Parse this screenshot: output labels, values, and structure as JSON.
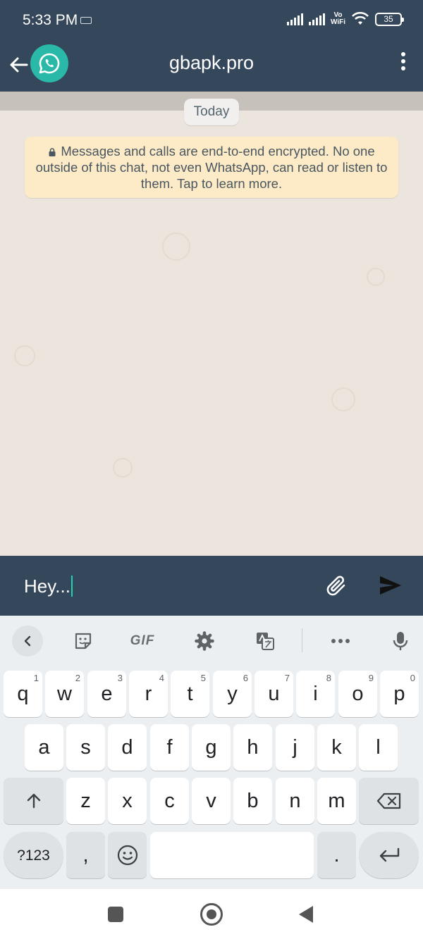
{
  "status_bar": {
    "time": "5:33 PM",
    "vowifi_top": "Vo",
    "vowifi_bottom": "WiFi",
    "battery": "35"
  },
  "header": {
    "title": "gbapk.pro",
    "back_icon": "arrow-left-icon",
    "avatar_icon": "whatsapp-logo-icon",
    "menu_icon": "more-vertical-icon"
  },
  "chat": {
    "date_label": "Today",
    "encryption_notice": "Messages and calls are end-to-end encrypted. No one outside of this chat, not even WhatsApp, can read or listen to them. Tap to learn more."
  },
  "compose": {
    "input_value": "Hey...",
    "attach_icon": "paperclip-icon",
    "send_icon": "send-icon"
  },
  "keyboard": {
    "toolbar": {
      "gif_label": "GIF"
    },
    "row1": [
      {
        "label": "q",
        "hint": "1"
      },
      {
        "label": "w",
        "hint": "2"
      },
      {
        "label": "e",
        "hint": "3"
      },
      {
        "label": "r",
        "hint": "4"
      },
      {
        "label": "t",
        "hint": "5"
      },
      {
        "label": "y",
        "hint": "6"
      },
      {
        "label": "u",
        "hint": "7"
      },
      {
        "label": "i",
        "hint": "8"
      },
      {
        "label": "o",
        "hint": "9"
      },
      {
        "label": "p",
        "hint": "0"
      }
    ],
    "row2": [
      "a",
      "s",
      "d",
      "f",
      "g",
      "h",
      "j",
      "k",
      "l"
    ],
    "row3": [
      "z",
      "x",
      "c",
      "v",
      "b",
      "n",
      "m"
    ],
    "row4": {
      "symbols_label": "?123",
      "comma_label": ",",
      "period_label": "."
    }
  },
  "colors": {
    "header_bg": "#35475a",
    "chat_bg": "#ece5dd",
    "notice_bg": "#fcebc6",
    "accent": "#25d0b2"
  }
}
